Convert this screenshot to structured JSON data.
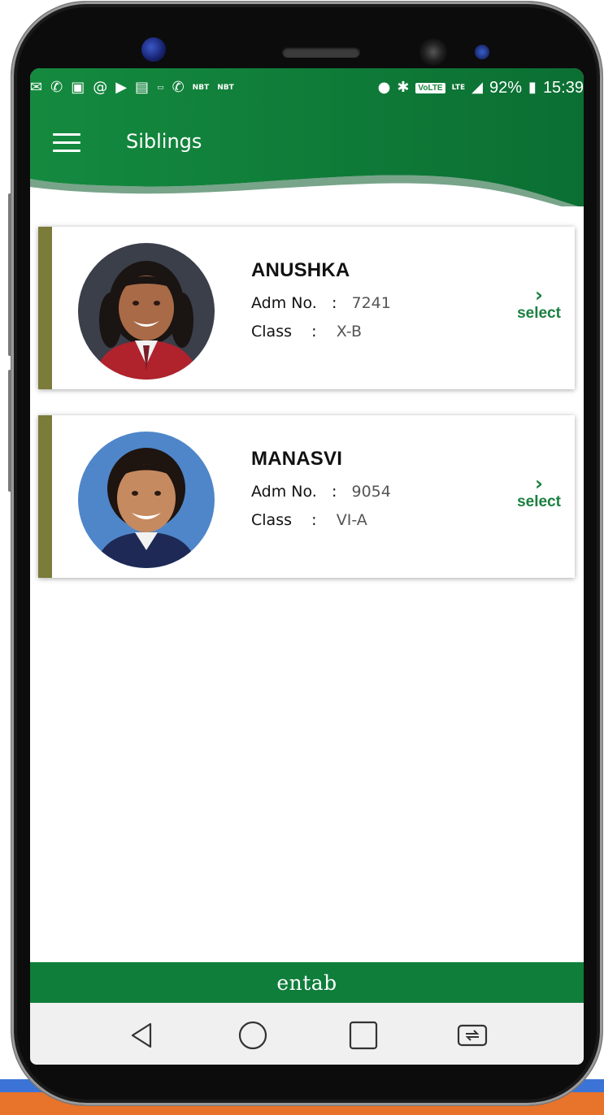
{
  "status_bar": {
    "network_labels": [
      "NBT",
      "NBT"
    ],
    "volte": "VoLTE",
    "lte": "LTE",
    "battery": "92%",
    "time": "15:39"
  },
  "header": {
    "title": "Siblings"
  },
  "students": [
    {
      "name": "ANUSHKA",
      "adm_label": "Adm No.",
      "adm_no": "7241",
      "class_label": "Class",
      "class_value": "X-B",
      "select_label": "select"
    },
    {
      "name": "MANASVI",
      "adm_label": "Adm No.",
      "adm_no": "9054",
      "class_label": "Class",
      "class_value": "VI-A",
      "select_label": "select"
    }
  ],
  "footer": {
    "brand": "entab"
  },
  "colors": {
    "primary_green": "#0f7e3a",
    "card_accent": "#7b7b3a",
    "select_green": "#1a8040"
  },
  "icons": {
    "menu": "hamburger-icon",
    "select": "chevron-right-icon",
    "nav": [
      "back-icon",
      "home-icon",
      "recents-icon",
      "app-switch-icon"
    ]
  }
}
